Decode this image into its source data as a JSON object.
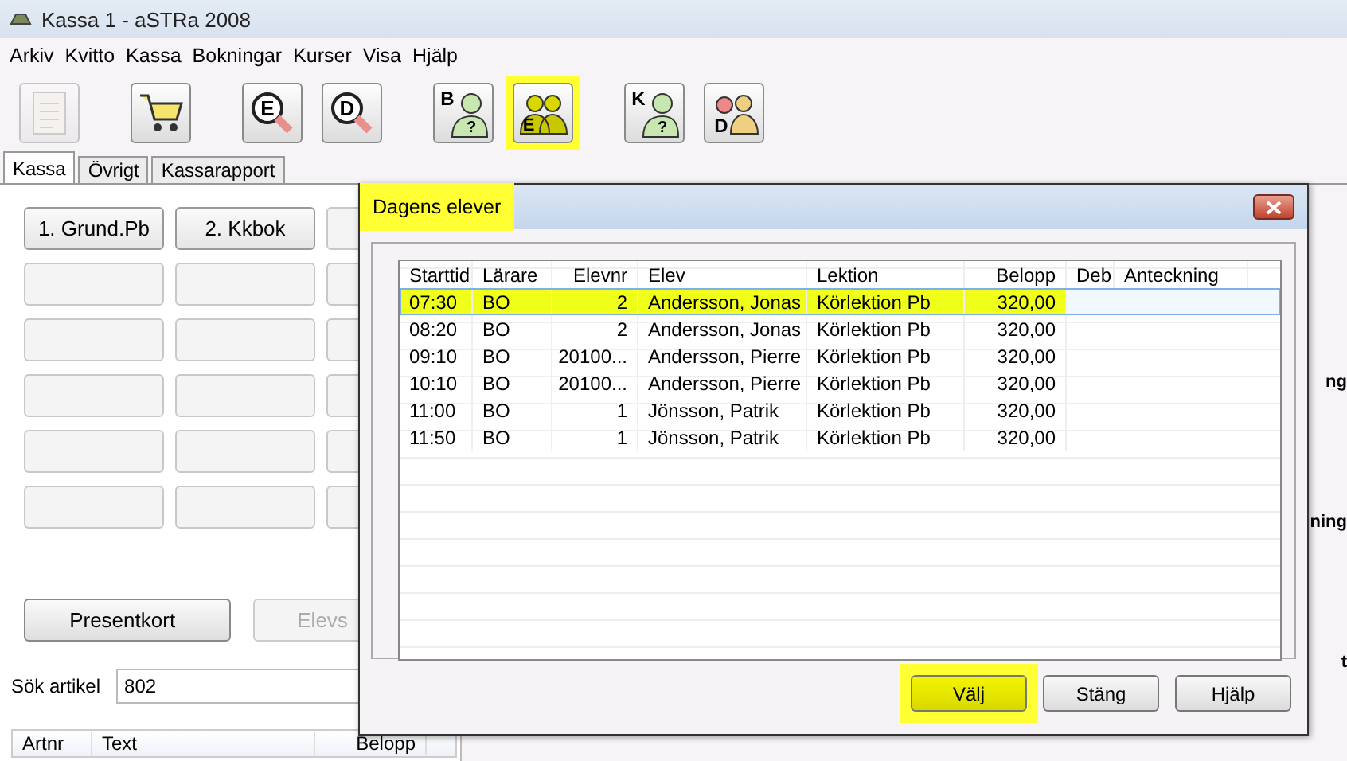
{
  "window": {
    "title": "Kassa 1 - aSTRa 2008"
  },
  "menu": [
    "Arkiv",
    "Kvitto",
    "Kassa",
    "Bokningar",
    "Kurser",
    "Visa",
    "Hjälp"
  ],
  "toolbar": [
    [
      {
        "kind": "document",
        "disabled": true,
        "highlighted": false
      }
    ],
    [
      {
        "kind": "cart",
        "disabled": false,
        "highlighted": false
      }
    ],
    [
      {
        "kind": "search",
        "letter": "E",
        "disabled": false,
        "highlighted": false
      },
      {
        "kind": "search",
        "letter": "D",
        "disabled": false,
        "highlighted": false
      }
    ],
    [
      {
        "kind": "people",
        "letter": "B",
        "mark": "?",
        "disabled": false,
        "highlighted": false
      },
      {
        "kind": "group",
        "letter": "E",
        "disabled": false,
        "highlighted": true
      }
    ],
    [
      {
        "kind": "people",
        "letter": "K",
        "mark": "?",
        "disabled": false,
        "highlighted": false
      },
      {
        "kind": "pair",
        "letter": "D",
        "disabled": false,
        "highlighted": false
      }
    ]
  ],
  "tabs": [
    {
      "label": "Kassa",
      "selected": true
    },
    {
      "label": "Övrigt",
      "selected": false
    },
    {
      "label": "Kassarapport",
      "selected": false
    }
  ],
  "quick_buttons": [
    "1. Grund.Pb",
    "2. Kkbok"
  ],
  "action_buttons": [
    {
      "label": "Presentkort",
      "disabled": false
    },
    {
      "label": "Elevs",
      "disabled": true
    }
  ],
  "search": {
    "label": "Sök artikel",
    "value": "802"
  },
  "article_table": {
    "columns": [
      "Artnr",
      "Text",
      "Belopp"
    ]
  },
  "right_labels": [
    "ng",
    "ning",
    "t"
  ],
  "dialog": {
    "title": "Dagens elever",
    "title_highlighted": true,
    "columns": [
      "Starttid",
      "Lärare",
      "Elevnr",
      "Elev",
      "Lektion",
      "Belopp",
      "Deb",
      "Anteckning"
    ],
    "rows": [
      {
        "cells": [
          "07:30",
          "BO",
          "2",
          "Andersson, Jonas",
          "Körlektion Pb",
          "320,00"
        ],
        "selected": true,
        "highlighted": true
      },
      {
        "cells": [
          "08:20",
          "BO",
          "2",
          "Andersson, Jonas",
          "Körlektion Pb",
          "320,00"
        ],
        "selected": false,
        "highlighted": false
      },
      {
        "cells": [
          "09:10",
          "BO",
          "20100...",
          "Andersson, Pierre",
          "Körlektion Pb",
          "320,00"
        ],
        "selected": false,
        "highlighted": false
      },
      {
        "cells": [
          "10:10",
          "BO",
          "20100...",
          "Andersson, Pierre",
          "Körlektion Pb",
          "320,00"
        ],
        "selected": false,
        "highlighted": false
      },
      {
        "cells": [
          "11:00",
          "BO",
          "1",
          "Jönsson, Patrik",
          "Körlektion Pb",
          "320,00"
        ],
        "selected": false,
        "highlighted": false
      },
      {
        "cells": [
          "11:50",
          "BO",
          "1",
          "Jönsson, Patrik",
          "Körlektion Pb",
          "320,00"
        ],
        "selected": false,
        "highlighted": false
      }
    ],
    "buttons": [
      {
        "label": "Välj",
        "highlighted": true
      },
      {
        "label": "Stäng",
        "highlighted": false
      },
      {
        "label": "Hjälp",
        "highlighted": false
      }
    ]
  }
}
